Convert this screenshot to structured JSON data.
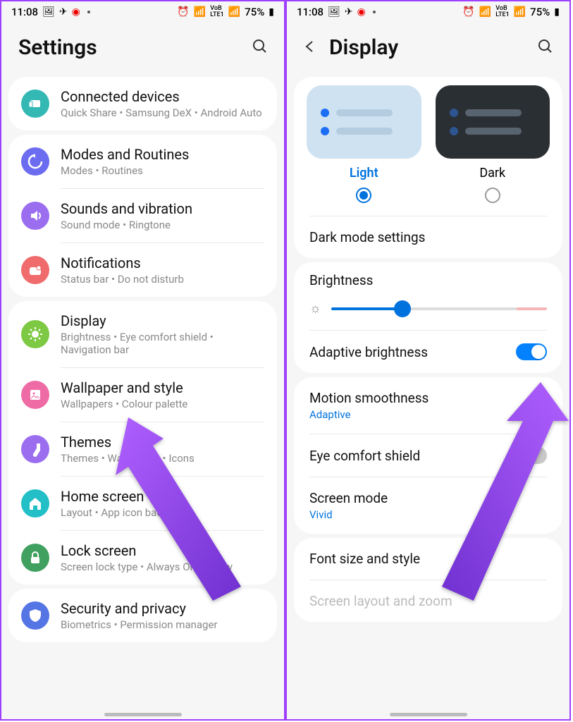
{
  "status": {
    "time": "11:08",
    "battery": "75%",
    "signal": "VoLTE1"
  },
  "left": {
    "title": "Settings",
    "items": [
      {
        "title": "Connected devices",
        "sub": "Quick Share  •  Samsung DeX  •  Android Auto",
        "color": "#33b8b4",
        "icon": "devices"
      },
      {
        "title": "Modes and Routines",
        "sub": "Modes  •  Routines",
        "color": "#6b6cf0",
        "icon": "routine"
      },
      {
        "title": "Sounds and vibration",
        "sub": "Sound mode  •  Ringtone",
        "color": "#9b6ef0",
        "icon": "sound"
      },
      {
        "title": "Notifications",
        "sub": "Status bar  •  Do not disturb",
        "color": "#f06b6b",
        "icon": "notif"
      },
      {
        "title": "Display",
        "sub": "Brightness  •  Eye comfort shield  •  Navigation bar",
        "color": "#7dc943",
        "icon": "display"
      },
      {
        "title": "Wallpaper and style",
        "sub": "Wallpapers  •  Colour palette",
        "color": "#ee6ba5",
        "icon": "wallpaper"
      },
      {
        "title": "Themes",
        "sub": "Themes  •  Wallpapers  •  Icons",
        "color": "#9b6ef0",
        "icon": "theme"
      },
      {
        "title": "Home screen",
        "sub": "Layout  •  App icon badges",
        "color": "#22bfc7",
        "icon": "home"
      },
      {
        "title": "Lock screen",
        "sub": "Screen lock type  •  Always On Display",
        "color": "#40a060",
        "icon": "lock"
      },
      {
        "title": "Security and privacy",
        "sub": "Biometrics  •  Permission manager",
        "color": "#5575e5",
        "icon": "shield"
      }
    ]
  },
  "right": {
    "title": "Display",
    "light_label": "Light",
    "dark_label": "Dark",
    "dark_mode_settings": "Dark mode settings",
    "brightness": "Brightness",
    "brightness_value": 33,
    "adaptive_brightness": "Adaptive brightness",
    "motion_smoothness": "Motion smoothness",
    "motion_smoothness_value": "Adaptive",
    "eye_comfort": "Eye comfort shield",
    "screen_mode": "Screen mode",
    "screen_mode_value": "Vivid",
    "font_size": "Font size and style",
    "screen_layout": "Screen layout and zoom"
  }
}
